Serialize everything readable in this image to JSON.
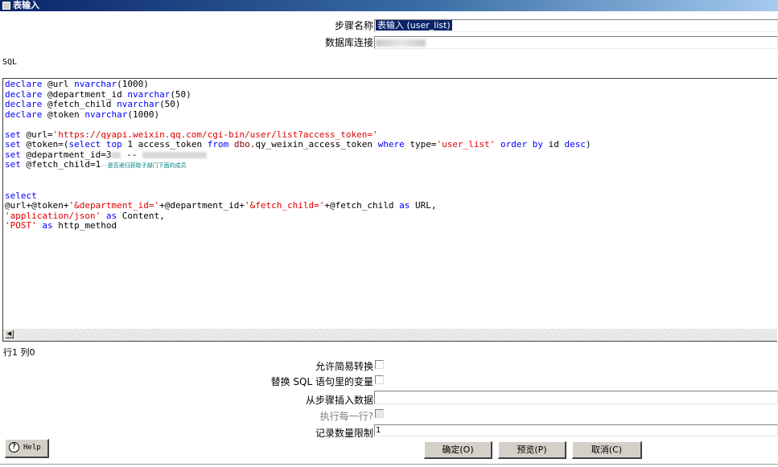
{
  "window": {
    "title": "表输入"
  },
  "form": {
    "step_name_label": "步骤名称",
    "step_name_value": "表输入 (user_list)",
    "connection_label": "数据库连接",
    "sql_label": "SQL"
  },
  "sql_editor": {
    "lines": {
      "l1": {
        "kw": "declare",
        "var": " @url ",
        "type": "nvarchar",
        "rest": "(1000)"
      },
      "l2": {
        "kw": "declare",
        "var": " @department_id ",
        "type": "nvarchar",
        "rest": "(50)"
      },
      "l3": {
        "kw": "declare",
        "var": " @fetch_child ",
        "type": "nvarchar",
        "rest": "(50)"
      },
      "l4": {
        "kw": "declare",
        "var": " @token ",
        "type": "nvarchar",
        "rest": "(1000)"
      },
      "l6": {
        "kw": "set",
        "var": " @url=",
        "str": "'https://qyapi.weixin.qq.com/cgi-bin/user/list?access_token='"
      },
      "l7": {
        "kw": "set",
        "a": " @token=(",
        "select": "select",
        "top": "top",
        "b": " 1 access_token ",
        "from": "from",
        "schema": "dbo.",
        "table": "qy_weixin_access_token ",
        "where": "where",
        "c": " type=",
        "str": "'user_list'",
        "order": "order by",
        "d": " id ",
        "desc": "desc",
        "e": ")"
      },
      "l8": {
        "kw": "set",
        "var": " @department_id=3",
        "mid": " -- "
      },
      "l9": {
        "kw": "set",
        "var": " @fetch_child=1",
        "comment": "--是否递归获取子部门下面的成员"
      },
      "l12": {
        "kw": "select"
      },
      "l13": {
        "a": "@url+@token+",
        "s1": "'&department_id='",
        "b": "+@department_id+",
        "s2": "'&fetch_child='",
        "c": "+@fetch_child ",
        "as": "as",
        "d": " URL,"
      },
      "l14": {
        "str": "'application/json'",
        "as": "as",
        "rest": " Content,"
      },
      "l15": {
        "str": "'POST'",
        "as": "as",
        "rest": " http_method"
      }
    }
  },
  "status": {
    "row_col": "行1 列0"
  },
  "options": {
    "lazy_conversion_label": "允许简易转换",
    "replace_vars_label": "替换 SQL 语句里的变量",
    "insert_from_step_label": "从步骤插入数据",
    "execute_each_row_label": "执行每一行?",
    "record_limit_label": "记录数量限制",
    "record_limit_value": "1"
  },
  "buttons": {
    "help": "Help",
    "ok": "确定(O)",
    "preview": "预览(P)",
    "cancel": "取消(C)"
  }
}
